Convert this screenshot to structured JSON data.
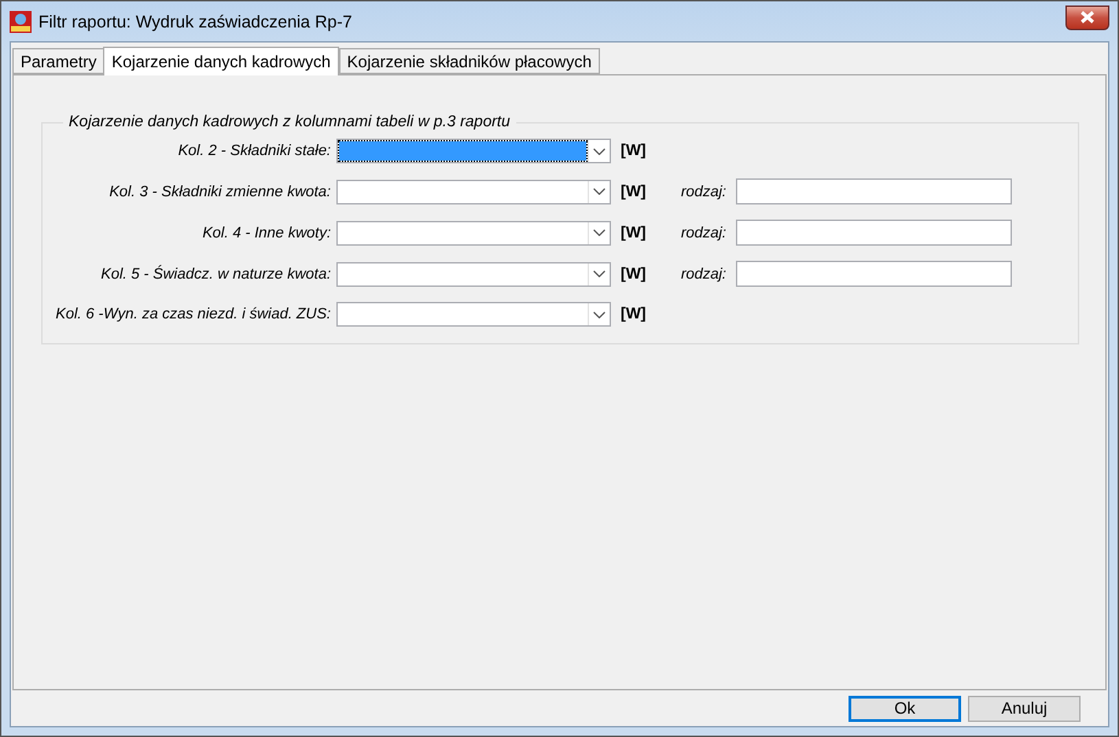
{
  "window": {
    "title": "Filtr raportu: Wydruk zaświadczenia Rp-7"
  },
  "tabs": [
    {
      "label": "Parametry",
      "selected": false
    },
    {
      "label": "Kojarzenie danych kadrowych",
      "selected": true
    },
    {
      "label": "Kojarzenie składników płacowych",
      "selected": false
    }
  ],
  "group": {
    "title": "Kojarzenie danych kadrowych z kolumnami tabeli w p.3 raportu",
    "rows": [
      {
        "label": "Kol. 2 - Składniki stałe:",
        "focused": true,
        "suffix": "[W]"
      },
      {
        "label": "Kol. 3 - Składniki zmienne kwota:",
        "focused": false,
        "suffix": "[W]",
        "type_label": "rodzaj:"
      },
      {
        "label": "Kol. 4 - Inne kwoty:",
        "focused": false,
        "suffix": "[W]",
        "type_label": "rodzaj:"
      },
      {
        "label": "Kol. 5 - Świadcz. w naturze kwota:",
        "focused": false,
        "suffix": "[W]",
        "type_label": "rodzaj:"
      },
      {
        "label": "Kol. 6 -Wyn. za czas niezd. i świad. ZUS:",
        "focused": false,
        "suffix": "[W]"
      }
    ]
  },
  "buttons": [
    {
      "label": "Ok",
      "default": true
    },
    {
      "label": "Anuluj",
      "default": false
    }
  ]
}
